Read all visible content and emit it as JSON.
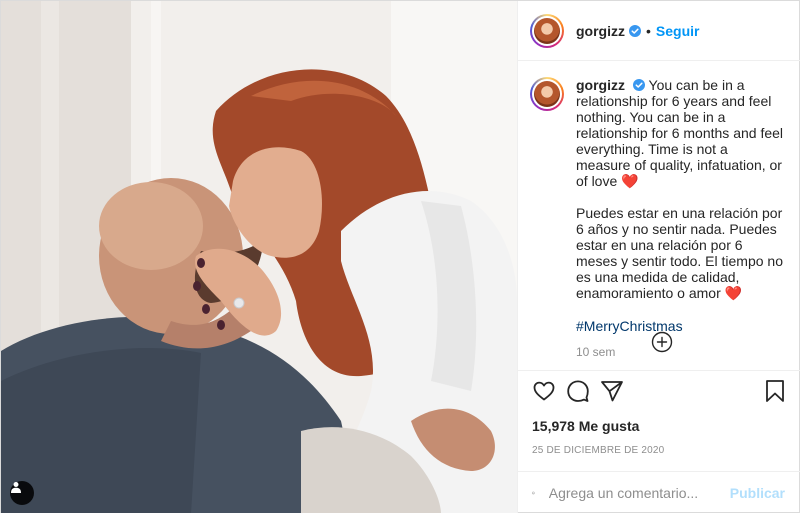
{
  "post": {
    "username": "gorgizz",
    "follow_label": "Seguir",
    "separator": "•",
    "caption_en": "You can be in a relationship for 6 years and feel nothing. You can be in a relationship for 6 months and feel everything. Time is not a measure of quality, infatuation, or of love ❤️",
    "caption_es": "Puedes estar en una relación por 6 años y no sentir nada. Puedes estar en una relación por 6 meses y sentir todo. El tiempo no es una medida de calidad, enamoramiento o amor ❤️",
    "hashtag": "#MerryChristmas",
    "age": "10 sem",
    "likes": "15,978 Me gusta",
    "date": "25 DE DICIEMBRE DE 2020"
  },
  "comment_box": {
    "placeholder": "Agrega un comentario...",
    "publish_label": "Publicar"
  },
  "icons": {
    "verified": "verified-badge-icon",
    "like": "heart-icon",
    "comment": "comment-icon",
    "share": "paper-plane-icon",
    "save": "bookmark-icon",
    "load_more": "plus-circle-icon",
    "emoji": "emoji-icon",
    "tagged_users": "user-tag-icon"
  },
  "colors": {
    "link_blue": "#0095f6",
    "hashtag": "#00376b",
    "muted": "#8e8e8e",
    "publish_disabled": "#b2dffc"
  }
}
